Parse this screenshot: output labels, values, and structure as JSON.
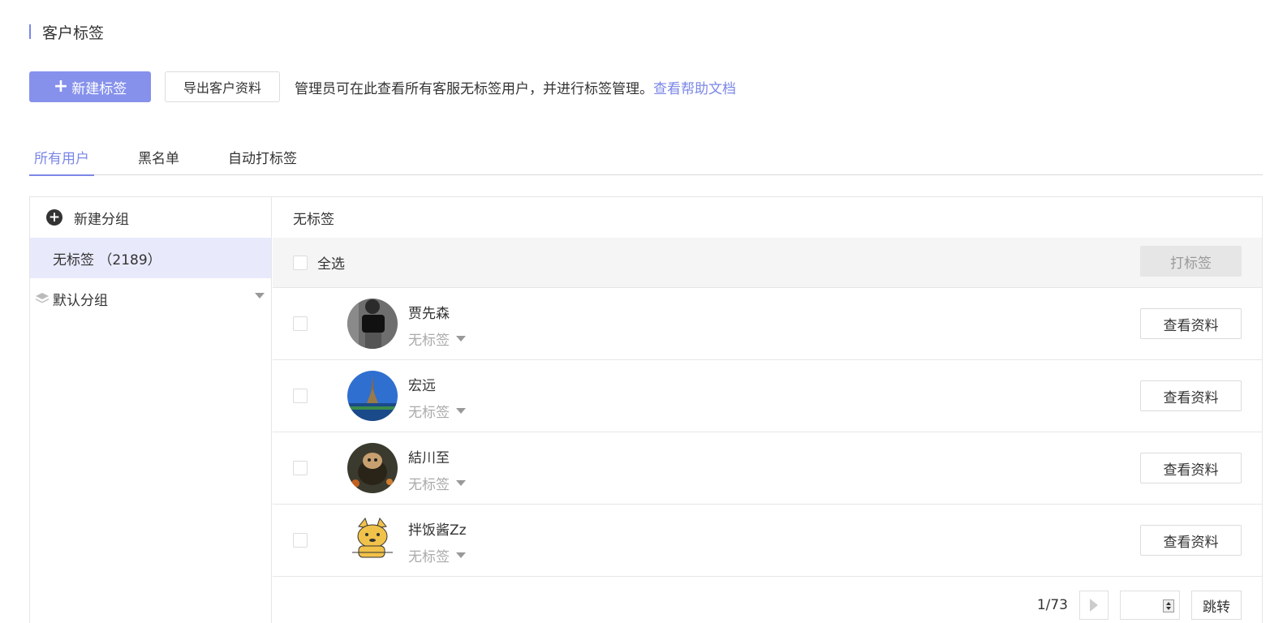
{
  "page": {
    "title": "客户标签"
  },
  "toolbar": {
    "new_tag_label": "新建标签",
    "export_label": "导出客户资料",
    "tip_text": "管理员可在此查看所有客服无标签用户，并进行标签管理。",
    "help_link": "查看帮助文档"
  },
  "tabs": [
    {
      "label": "所有用户",
      "active": true
    },
    {
      "label": "黑名单",
      "active": false
    },
    {
      "label": "自动打标签",
      "active": false
    }
  ],
  "sidebar": {
    "new_group_label": "新建分组",
    "untagged_label": "无标签 （2189）",
    "default_group_label": "默认分组"
  },
  "main": {
    "header": "无标签",
    "select_all_label": "全选",
    "tag_button_label": "打标签",
    "rows": [
      {
        "name": "贾先森",
        "tag": "无标签",
        "button": "查看资料",
        "avatar": "avatar-dark"
      },
      {
        "name": "宏远",
        "tag": "无标签",
        "button": "查看资料",
        "avatar": "avatar-eiffel"
      },
      {
        "name": "結川至",
        "tag": "无标签",
        "button": "查看资料",
        "avatar": "avatar-animal"
      },
      {
        "name": "拌饭酱Zz",
        "tag": "无标签",
        "button": "查看资料",
        "avatar": "avatar-doge"
      }
    ]
  },
  "pager": {
    "info": "1/73",
    "jump_label": "跳转"
  },
  "colors": {
    "accent": "#7b87e6",
    "primary_button": "#8691ec",
    "selected_bg": "#e8eafc"
  }
}
